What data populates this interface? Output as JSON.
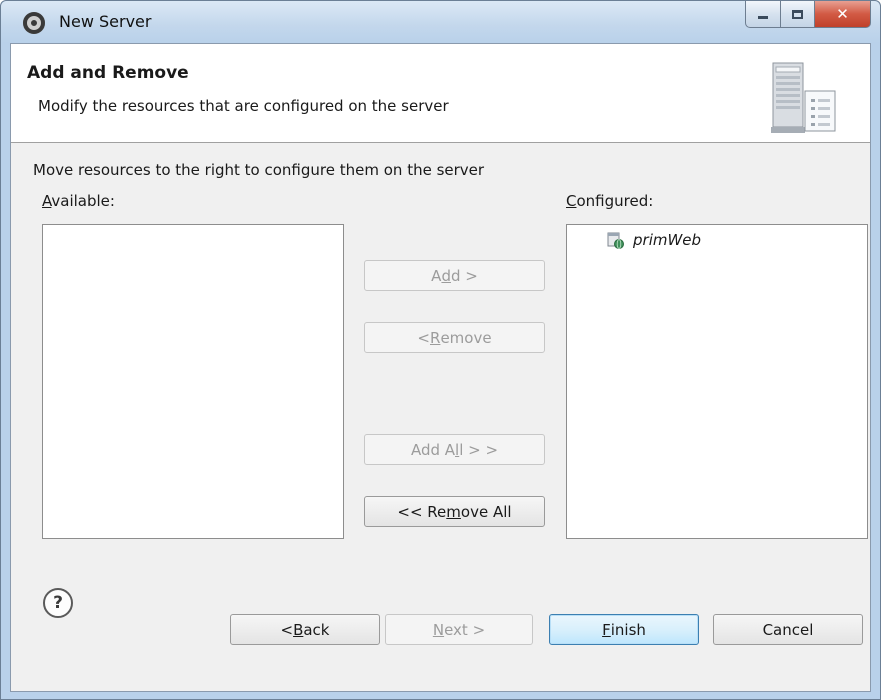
{
  "window": {
    "title": "New Server",
    "app_icon": "eclipse-server-icon",
    "controls": {
      "minimize": "minimize-icon",
      "maximize": "maximize-icon",
      "close": "close-icon"
    }
  },
  "banner": {
    "title": "Add and Remove",
    "description": "Modify the resources that are configured on the server",
    "graphic": "server-wizard-graphic"
  },
  "instructions": "Move resources to the right to configure them on the server",
  "available": {
    "label_mnemonic": "A",
    "label_rest": "vailable:",
    "items": []
  },
  "configured": {
    "label_mnemonic": "C",
    "label_rest": "onfigured:",
    "items": [
      {
        "label": "primWeb",
        "icon": "web-module-icon"
      }
    ]
  },
  "move_buttons": {
    "add": {
      "pre": "A",
      "mn": "d",
      "post": "d >",
      "enabled": false
    },
    "remove": {
      "pre": "< ",
      "mn": "R",
      "post": "emove",
      "enabled": false
    },
    "add_all": {
      "pre": "Add A",
      "mn": "l",
      "post": "l > >",
      "enabled": false
    },
    "remove_all": {
      "pre": "<< Re",
      "mn": "m",
      "post": "ove All",
      "enabled": true
    }
  },
  "footer": {
    "help_icon": "help-icon",
    "help_glyph": "?",
    "back": {
      "pre": "< ",
      "mn": "B",
      "post": "ack",
      "enabled": true
    },
    "next": {
      "pre": "",
      "mn": "N",
      "post": "ext >",
      "enabled": false
    },
    "finish": {
      "pre": "",
      "mn": "F",
      "post": "inish",
      "enabled": true
    },
    "cancel": {
      "label": "Cancel",
      "enabled": true
    }
  }
}
